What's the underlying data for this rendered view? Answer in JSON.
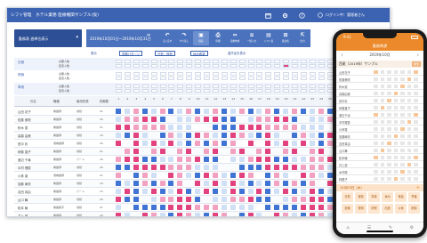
{
  "window": {
    "title": "シフト管理　ホテル業務 医療機関サンプル(仮)",
    "user_label": "ログイン中：管理者さん",
    "icons": [
      "calendar-icon",
      "gear-icon",
      "help-icon",
      "user-icon"
    ]
  },
  "toolbar": {
    "view_selector": "勤務表 週単位表示",
    "view_chevron": "▾",
    "date_range": "2019年10月01日〜2019年10月31日",
    "nav_prev": "‹",
    "nav_next": "›",
    "buttons": [
      {
        "glyph": "↶",
        "label": "元に戻す"
      },
      {
        "glyph": "↷",
        "label": "やり直し"
      },
      {
        "glyph": "▣",
        "label": "保存"
      },
      {
        "glyph": "⎙",
        "label": "印刷"
      },
      {
        "glyph": "⇔",
        "label": "自動作成"
      },
      {
        "glyph": "≡",
        "label": "一括入力"
      },
      {
        "glyph": "▤",
        "label": "シフト表"
      },
      {
        "glyph": "⊞",
        "label": "集計表"
      },
      {
        "glyph": "⇱",
        "label": "出力"
      }
    ]
  },
  "filters": [
    {
      "label": "表示",
      "boxed": false
    },
    {
      "label": "勤務パターン",
      "boxed": true
    },
    {
      "label": "日勤・夜勤",
      "boxed": true
    },
    {
      "label": "休み希望",
      "boxed": true
    },
    {
      "label": "過不足を表示",
      "boxed": false
    }
  ],
  "summary_bands": [
    {
      "label": "日勤",
      "sub": [
        "必要人数",
        "配置人数"
      ]
    },
    {
      "label": "夜勤",
      "sub": [
        "必要人数",
        "配置人数"
      ]
    },
    {
      "label": "準夜",
      "sub": [
        "必要人数",
        "配置人数"
      ]
    }
  ],
  "grid": {
    "headers": {
      "name": "氏名",
      "c1": "職種",
      "c2": "雇用形態",
      "c3": "勤務数"
    },
    "days": [
      "1",
      "2",
      "3",
      "4",
      "5",
      "6",
      "7",
      "8",
      "9",
      "10",
      "11",
      "12",
      "13",
      "14",
      "15",
      "16",
      "17",
      "18",
      "19",
      "20",
      "21",
      "22",
      "23",
      "24",
      "25",
      "26",
      "27",
      "28",
      "29",
      "30",
      "31"
    ],
    "rows": [
      {
        "name": "山田 花子",
        "c1": "看護師",
        "c2": "常勤",
        "c3": "21"
      },
      {
        "name": "佐藤 美咲",
        "c1": "看護師",
        "c2": "常勤",
        "c3": "20"
      },
      {
        "name": "鈴木 恵",
        "c1": "看護師",
        "c2": "常勤",
        "c3": "21"
      },
      {
        "name": "高橋 由美",
        "c1": "看護師",
        "c2": "常勤",
        "c3": "19"
      },
      {
        "name": "田中 彩",
        "c1": "准看護師",
        "c2": "常勤",
        "c3": "20"
      },
      {
        "name": "伊藤 直子",
        "c1": "看護師",
        "c2": "常勤",
        "c3": "21"
      },
      {
        "name": "渡辺 千尋",
        "c1": "看護師",
        "c2": "パート",
        "c3": "16"
      },
      {
        "name": "中村 理恵",
        "c1": "看護師",
        "c2": "常勤",
        "c3": "20"
      },
      {
        "name": "小林 香",
        "c1": "准看護師",
        "c2": "常勤",
        "c3": "21"
      },
      {
        "name": "加藤 麻衣",
        "c1": "看護師",
        "c2": "常勤",
        "c3": "19"
      },
      {
        "name": "吉田 真由",
        "c1": "看護師",
        "c2": "パート",
        "c3": "15"
      },
      {
        "name": "山口 舞",
        "c1": "看護師",
        "c2": "常勤",
        "c3": "20"
      },
      {
        "name": "松本 綾",
        "c1": "看護助手",
        "c2": "常勤",
        "c3": "21"
      },
      {
        "name": "井上 愛",
        "c1": "看護師",
        "c2": "常勤",
        "c3": "20"
      }
    ],
    "legend_colors": {
      "day": "#3f73d4",
      "night": "#e2427e",
      "evening": "#f2a2c0",
      "off": "#cfe0f6"
    }
  },
  "phone": {
    "time": "9:41",
    "header": "勤務希望",
    "month": "2019年10月",
    "prev": "‹",
    "next": "›",
    "selected_user": "西尾（2019年）サンプル",
    "selected_tag": "希望",
    "names": [
      "山田花子",
      "佐藤美咲",
      "鈴木恵",
      "高橋由美",
      "田中彩",
      "伊藤直子",
      "渡辺千尋",
      "中村理恵",
      "小林香",
      "加藤麻衣",
      "吉田真由",
      "山口舞",
      "松本綾",
      "井上愛",
      "木村瞳",
      "林優子"
    ],
    "bar_label": "10月03日（木）",
    "bar_plus": "+",
    "options": [
      "日勤",
      "夜勤",
      "準夜",
      "休み",
      "有給",
      "早番",
      "遅番",
      "夜明",
      "研修",
      "出張",
      "公休",
      "削除"
    ],
    "tabs": [
      "⌂",
      "☰",
      "✎",
      "⚙"
    ],
    "accent": "#ec8a2b"
  }
}
